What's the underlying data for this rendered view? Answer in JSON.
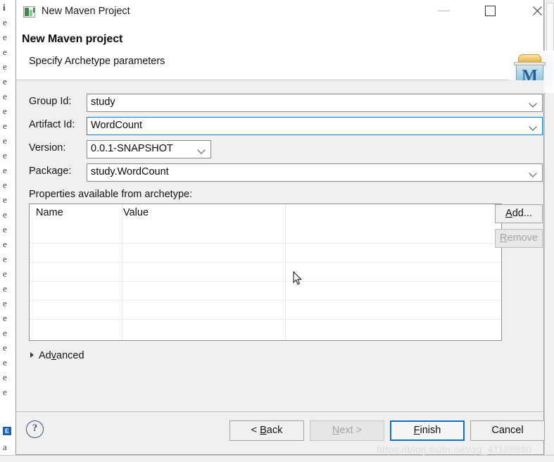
{
  "window": {
    "title": "New Maven Project",
    "icon": "maven-wizard-icon",
    "controls": {
      "minimize": "minimize-icon",
      "maximize": "maximize-icon",
      "close": "close-icon"
    }
  },
  "header": {
    "title": "New Maven project",
    "subtitle": "Specify Archetype parameters",
    "logo": "maven-logo",
    "logo_letter": "M"
  },
  "form": {
    "group_id": {
      "label": "Group Id:",
      "value": "study"
    },
    "artifact_id": {
      "label": "Artifact Id:",
      "value": "WordCount"
    },
    "version": {
      "label": "Version:",
      "value": "0.0.1-SNAPSHOT"
    },
    "package": {
      "label": "Package:",
      "value": "study.WordCount"
    }
  },
  "properties": {
    "label": "Properties available from archetype:",
    "columns": [
      "Name",
      "Value",
      ""
    ],
    "rows": [],
    "add_button": {
      "label": "Add...",
      "mnemonic": "A",
      "enabled": true
    },
    "remove_button": {
      "label": "Remove",
      "mnemonic": "R",
      "enabled": false
    }
  },
  "advanced": {
    "label": "Advanced",
    "mnemonic": "v",
    "expanded": false
  },
  "footer": {
    "help": "?",
    "buttons": [
      {
        "label": "< Back",
        "mnemonic": "B",
        "enabled": true,
        "default": false
      },
      {
        "label": "Next >",
        "mnemonic": "N",
        "enabled": false,
        "default": false
      },
      {
        "label": "Finish",
        "mnemonic": "F",
        "enabled": true,
        "default": true
      },
      {
        "label": "Cancel",
        "mnemonic": "",
        "enabled": true,
        "default": false
      }
    ]
  },
  "watermark": "https://blog.csdn.net/qq_41188880",
  "background": {
    "left_letters": [
      "i",
      "e",
      "e",
      "e",
      "e",
      "e",
      "e",
      "e",
      "e",
      "e",
      "e",
      "e",
      "e",
      "e",
      "e",
      "e",
      "e",
      "e",
      "e",
      "e",
      "e",
      "e",
      "e",
      "e",
      "e",
      "e",
      "e"
    ],
    "eclipse_icon": "E",
    "bottom_letter": "a"
  },
  "colors": {
    "accent": "#0a70c8",
    "focus_border": "#0f7cd1",
    "dialog_bg": "#f0f0f0",
    "header_bg": "#ffffff"
  }
}
